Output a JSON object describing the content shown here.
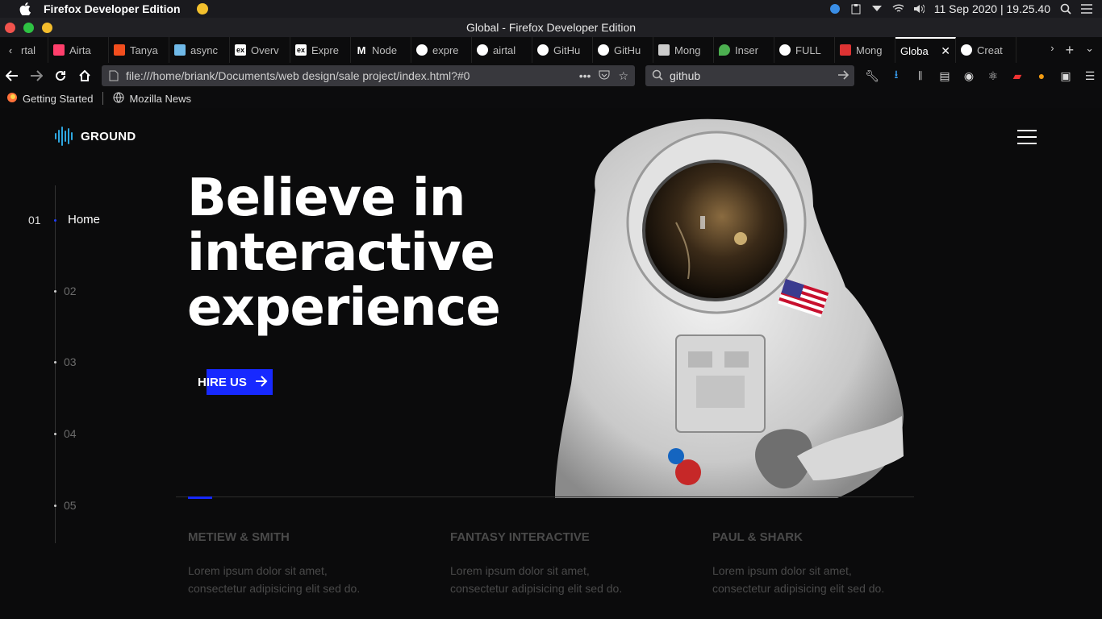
{
  "os": {
    "app_name": "Firefox Developer Edition",
    "clock": "11 Sep 2020 | 19.25.40"
  },
  "window": {
    "title": "Global - Firefox Developer Edition"
  },
  "tabs": [
    {
      "label": "rtal",
      "icon": "chevron-left-icon"
    },
    {
      "label": "Airta",
      "icon": "airtable-icon",
      "color": "#ff3f6c"
    },
    {
      "label": "Tanya",
      "icon": "figma-icon",
      "color": "#f24e1e"
    },
    {
      "label": "async",
      "icon": "bird-icon",
      "color": "#6fb9e8"
    },
    {
      "label": "Overv",
      "icon": "express-icon",
      "color": "#ffffff"
    },
    {
      "label": "Expre",
      "icon": "express-icon",
      "color": "#ffffff"
    },
    {
      "label": "Node",
      "icon": "medium-icon",
      "color": "#ffffff"
    },
    {
      "label": "expre",
      "icon": "github-icon",
      "color": "#ffffff"
    },
    {
      "label": "airtal",
      "icon": "github-icon",
      "color": "#ffffff"
    },
    {
      "label": "GitHu",
      "icon": "github-icon",
      "color": "#ffffff"
    },
    {
      "label": "GitHu",
      "icon": "github-icon",
      "color": "#ffffff"
    },
    {
      "label": "Mong",
      "icon": "book-icon",
      "color": "#ffffff"
    },
    {
      "label": "Inser",
      "icon": "mongodb-icon",
      "color": "#4caf50"
    },
    {
      "label": "FULL",
      "icon": "github-icon",
      "color": "#ffffff"
    },
    {
      "label": "Mong",
      "icon": "mongodb-icon",
      "color": "#d33"
    },
    {
      "label": "Globa",
      "icon": "",
      "active": true
    },
    {
      "label": "Creat",
      "icon": "github-icon",
      "color": "#ffffff"
    }
  ],
  "nav": {
    "url": "file:///home/briank/Documents/web design/sale project/index.html?#0",
    "search_value": "github"
  },
  "bookmarks": [
    {
      "label": "Getting Started",
      "icon": "firefox-icon"
    },
    {
      "label": "Mozilla News",
      "icon": "globe-icon"
    }
  ],
  "site": {
    "brand": "GROUND",
    "hero_title_line1": "Believe in",
    "hero_title_line2": "interactive",
    "hero_title_line3": "experience",
    "cta_label": "HIRE US",
    "accent": "#1729ff",
    "side_nav": {
      "active_number": "01",
      "active_label": "Home",
      "items": [
        "02",
        "03",
        "04",
        "05"
      ]
    },
    "clients": [
      {
        "name": "METIEW & SMITH",
        "text_line1": "Lorem ipsum dolor sit amet,",
        "text_line2": "consectetur adipisicing elit sed do."
      },
      {
        "name": "FANTASY INTERACTIVE",
        "text_line1": "Lorem ipsum dolor sit amet,",
        "text_line2": "consectetur adipisicing elit sed do."
      },
      {
        "name": "PAUL & SHARK",
        "text_line1": "Lorem ipsum dolor sit amet,",
        "text_line2": "consectetur adipisicing elit sed do."
      }
    ]
  }
}
